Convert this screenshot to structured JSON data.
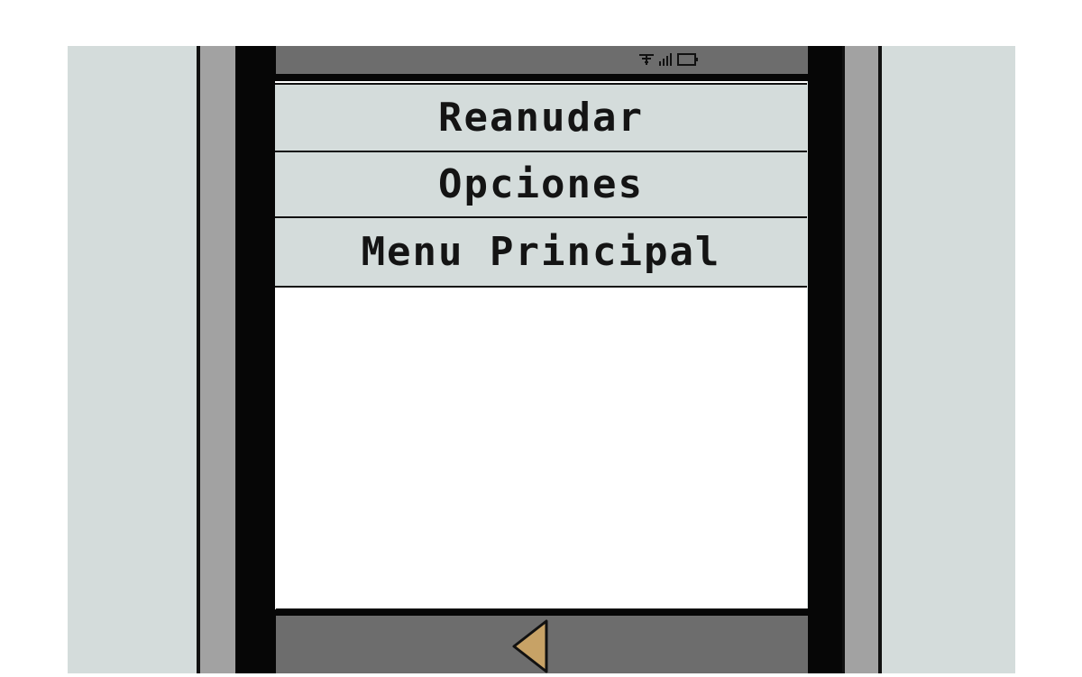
{
  "menu": {
    "items": [
      {
        "label": "Reanudar"
      },
      {
        "label": "Opciones"
      },
      {
        "label": "Menu Principal"
      }
    ]
  },
  "status_bar": {
    "icons": [
      "wifi-icon",
      "signal-icon",
      "battery-icon"
    ]
  },
  "nav_bar": {
    "back_icon": "back-triangle-icon"
  },
  "colors": {
    "backdrop": "#d4dcdb",
    "menu_item_bg": "#d4dcdb",
    "bar_gray": "#6d6d6d",
    "bezel_gray": "#a2a2a2",
    "bezel_black": "#060606",
    "back_icon_fill": "#c7a266"
  }
}
